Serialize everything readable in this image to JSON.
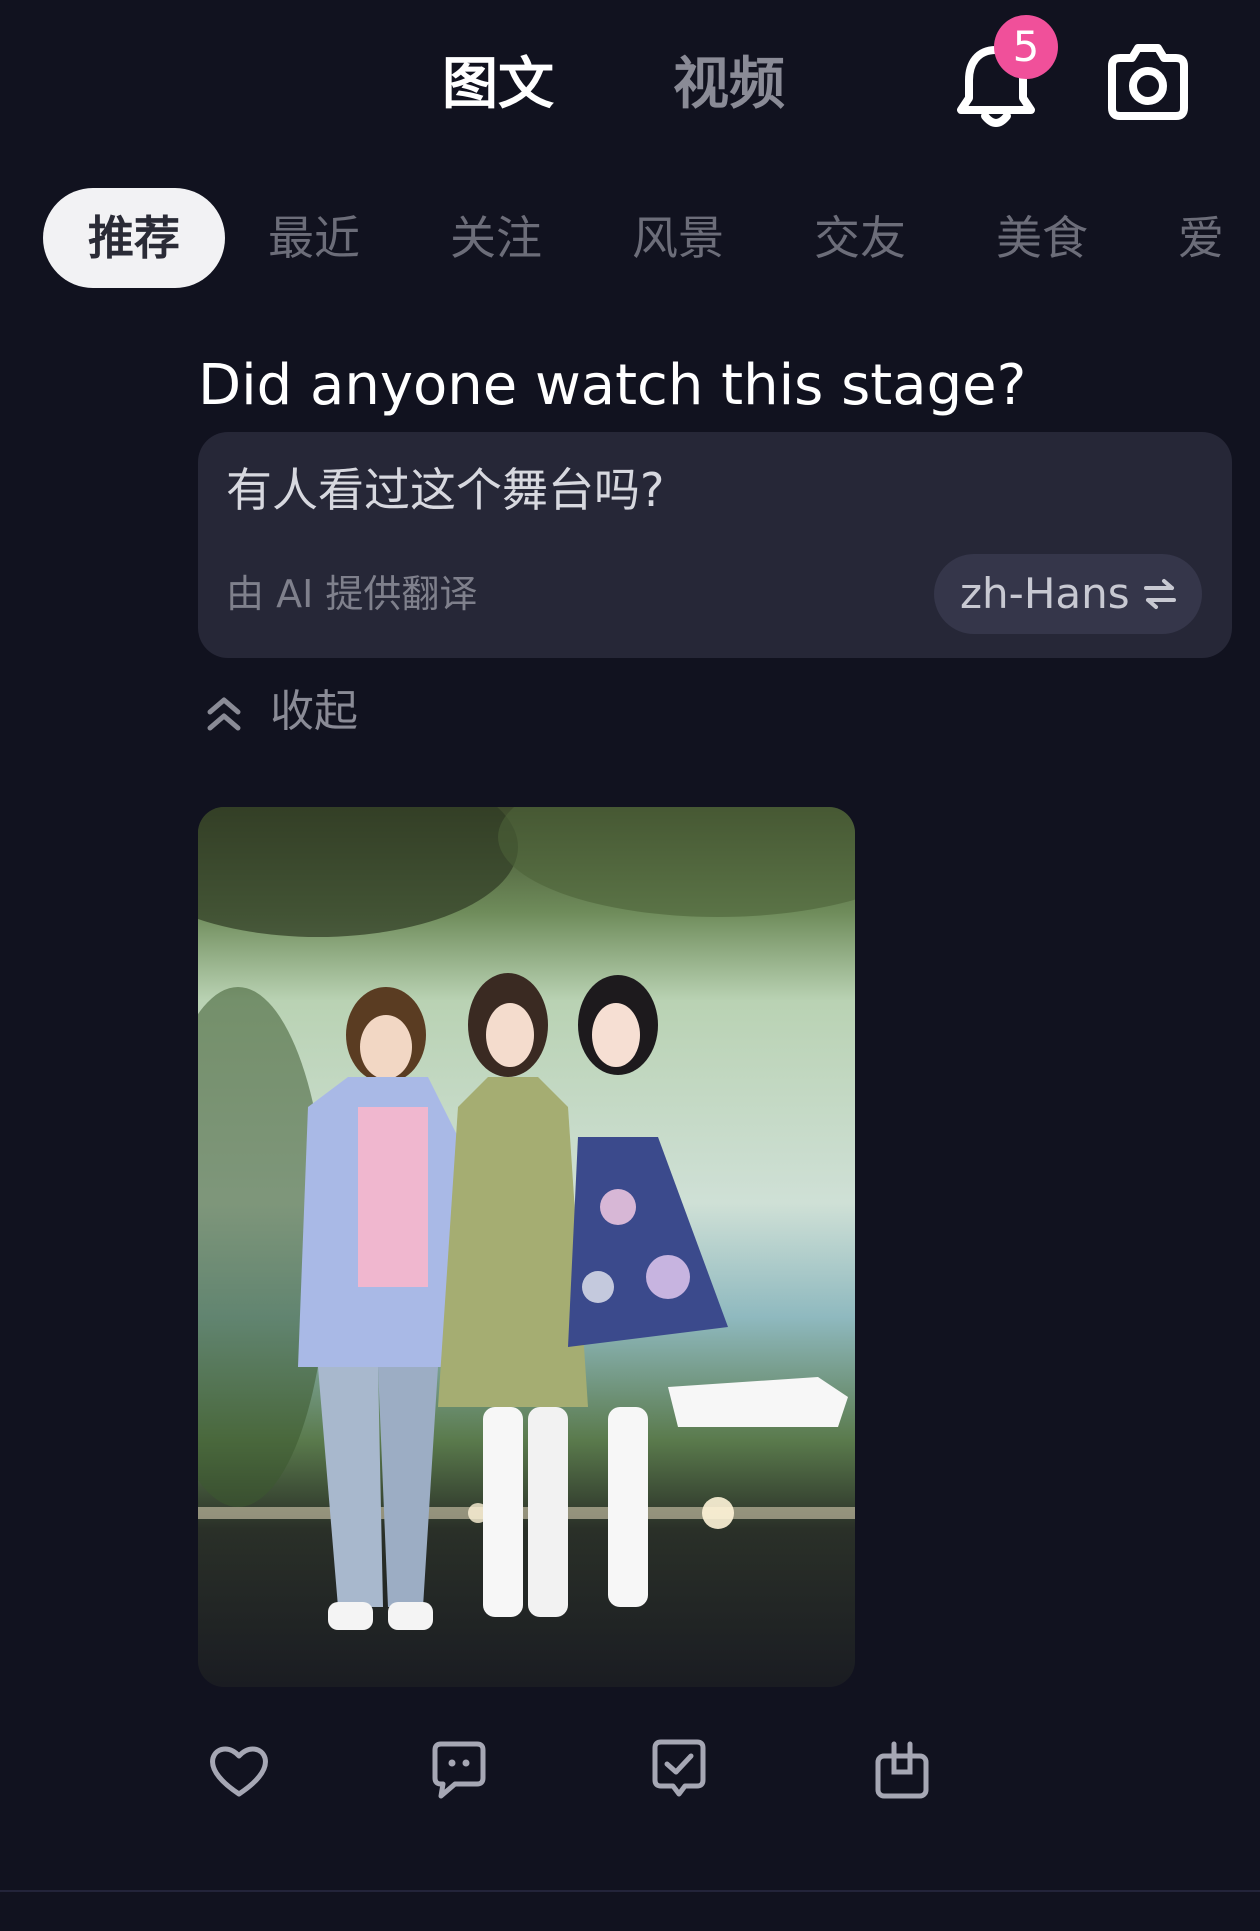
{
  "header": {
    "tabs": [
      {
        "label": "图文",
        "active": true
      },
      {
        "label": "视频",
        "active": false
      }
    ],
    "notification_count": "5",
    "bell_icon": "bell-icon",
    "camera_icon": "camera-icon",
    "badge_color": "#f0509a"
  },
  "categories": [
    {
      "label": "推荐",
      "active": true
    },
    {
      "label": "最近",
      "active": false
    },
    {
      "label": "关注",
      "active": false
    },
    {
      "label": "风景",
      "active": false
    },
    {
      "label": "交友",
      "active": false
    },
    {
      "label": "美食",
      "active": false
    },
    {
      "label": "爱",
      "active": false
    }
  ],
  "post": {
    "title": "Did anyone watch this stage?",
    "translation": {
      "text": "有人看过这个舞台吗?",
      "note": "由 AI 提供翻译",
      "language": "zh-Hans",
      "swap_icon": "swap-arrows-icon"
    },
    "collapse_label": "收起",
    "collapse_icon": "chevron-double-up-icon",
    "image_icon": "stage-photo"
  },
  "actions": [
    {
      "icon": "heart-icon"
    },
    {
      "icon": "comment-icon"
    },
    {
      "icon": "checked-message-icon"
    },
    {
      "icon": "gift-icon"
    }
  ],
  "colors": {
    "background": "#11121f",
    "card": "#262737",
    "accent": "#f0509a"
  }
}
